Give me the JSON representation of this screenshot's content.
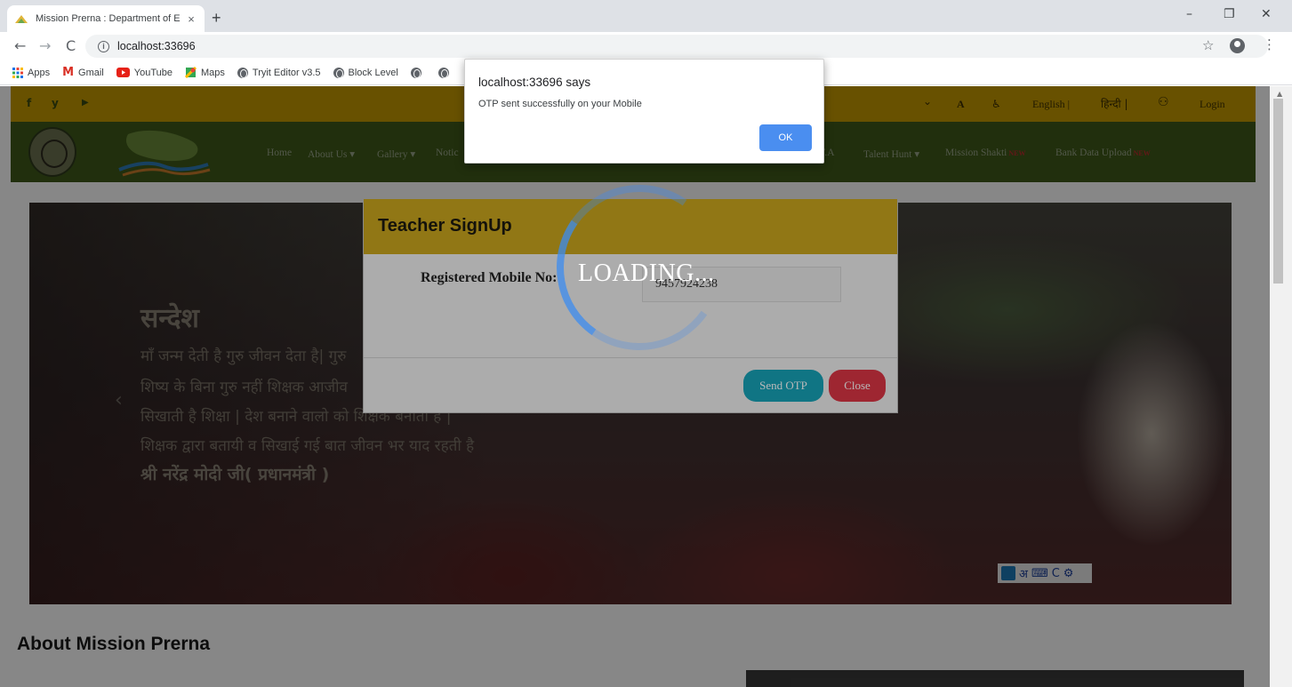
{
  "browser": {
    "tab_title": "Mission Prerna : Department of E",
    "tab_close": "×",
    "new_tab": "+",
    "url": "localhost:33696",
    "window_controls": {
      "minimize": "–",
      "restore": "❐",
      "close": "✕"
    },
    "nav": {
      "back": "←",
      "forward": "→",
      "reload": "C"
    },
    "star": "☆",
    "menu": "⋮",
    "bookmarks": [
      {
        "label": "Apps",
        "icon": "apps-grid-icon"
      },
      {
        "label": "Gmail",
        "icon": "gmail-icon"
      },
      {
        "label": "YouTube",
        "icon": "youtube-icon"
      },
      {
        "label": "Maps",
        "icon": "maps-icon"
      },
      {
        "label": "Tryit Editor v3.5",
        "icon": "globe-icon"
      },
      {
        "label": "Block Level",
        "icon": "globe-icon"
      },
      {
        "label": "",
        "icon": "globe-icon"
      },
      {
        "label": "",
        "icon": "globe-icon"
      }
    ]
  },
  "site": {
    "topbar": {
      "social": [
        "f",
        "y",
        "▶"
      ],
      "caret": "⌄",
      "font_a": "A",
      "accessibility": "♿",
      "english": "English |",
      "hindi": "हिन्दी |",
      "sitemap": "⚇",
      "login": "Login"
    },
    "nav": [
      {
        "label": "Home"
      },
      {
        "label": "About Us ▾"
      },
      {
        "label": "Gallery ▾"
      },
      {
        "label": "Notic"
      },
      {
        "label": "E.F.A"
      },
      {
        "label": "Talent Hunt ▾"
      },
      {
        "label": "Mission Shakti",
        "badge": "NEW"
      },
      {
        "label": "Bank Data Upload",
        "badge": "NEW"
      }
    ],
    "hero": {
      "heading": "सन्देश",
      "lines": [
        "माँ जन्म देती है गुरु जीवन देता है| गुरु",
        "शिष्य के बिना गुरु नहीं शिक्षक आजीव",
        "सिखाती है शिक्षा | देश बनाने वालो को शिक्षक बनाता है |",
        "शिक्षक द्वारा बतायी व सिखाई गई बात जीवन भर याद रहती है"
      ],
      "attribution": "श्री नरेंद्र मोदी जी( प्रधानमंत्री )",
      "prev_arrow": "‹",
      "ime": {
        "hindi": "अ",
        "keyboard": "⌨",
        "c": "C",
        "settings": "⚙"
      }
    },
    "about_heading": "About Mission Prerna"
  },
  "modal": {
    "title": "Teacher SignUp",
    "mobile_label": "Registered Mobile No:",
    "mobile_value": "9457924238",
    "send_otp": "Send OTP",
    "close": "Close"
  },
  "loader": {
    "text": "LOADING..."
  },
  "alert": {
    "title": "localhost:33696 says",
    "message": "OTP sent successfully on your Mobile",
    "ok": "OK"
  },
  "colors": {
    "topbar": "#c49a00",
    "navbar": "#3f5a1a",
    "modal_header": "#c9a51e",
    "send_otp": "#17a2b8",
    "close": "#dc3545",
    "alert_ok": "#4a8ef0"
  }
}
